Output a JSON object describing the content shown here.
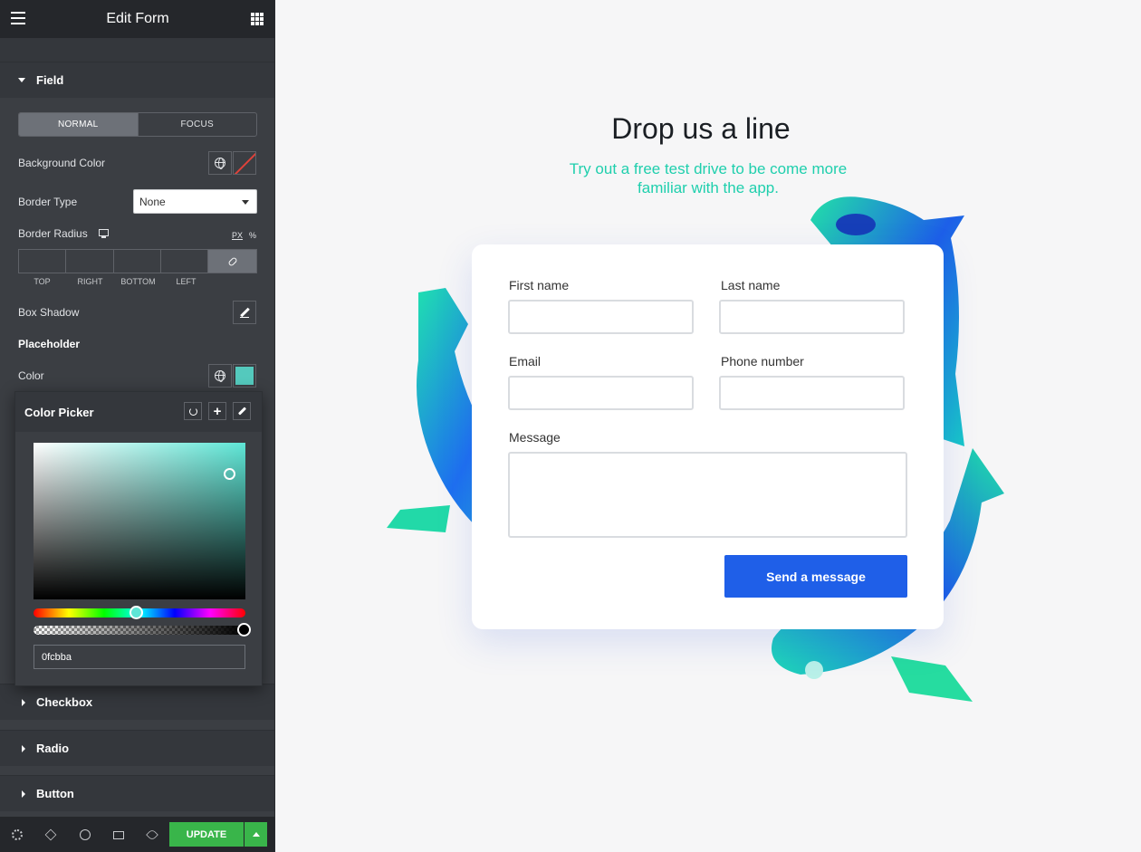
{
  "sidebar": {
    "title": "Edit Form",
    "field_section": "Field",
    "tabs": [
      {
        "label": "NORMAL",
        "active": true
      },
      {
        "label": "FOCUS",
        "active": false
      }
    ],
    "background_color_label": "Background Color",
    "border_type_label": "Border Type",
    "border_type_value": "None",
    "border_radius_label": "Border Radius",
    "units": {
      "px": "PX",
      "pct": "%"
    },
    "dimensions": [
      "TOP",
      "RIGHT",
      "BOTTOM",
      "LEFT"
    ],
    "box_shadow_label": "Box Shadow",
    "placeholder_heading": "Placeholder",
    "color_label": "Color",
    "placeholder_color": "#54c9bd",
    "collapsed_sections": [
      "Checkbox",
      "Radio",
      "Button"
    ],
    "update_label": "UPDATE"
  },
  "color_picker": {
    "title": "Color Picker",
    "hex_value": "0fcbba"
  },
  "canvas": {
    "headline": "Drop us a line",
    "subhead": "Try out a free test drive to be come more familiar with the app.",
    "fields": {
      "first_name": "First name",
      "last_name": "Last name",
      "email": "Email",
      "phone": "Phone number",
      "message": "Message"
    },
    "submit_label": "Send a message",
    "accent_color": "#1fcfad",
    "button_color": "#1f5fe8"
  }
}
